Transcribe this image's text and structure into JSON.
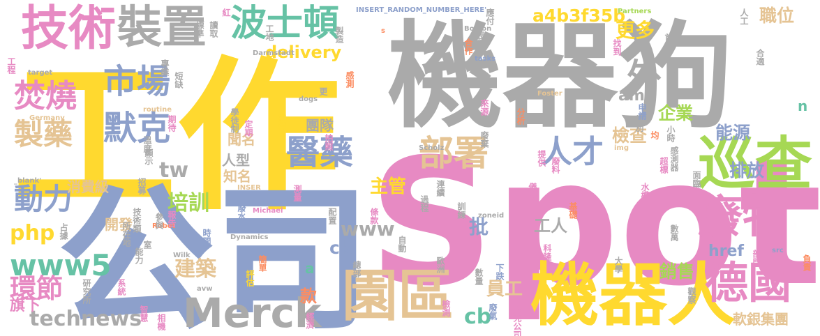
{
  "colors": {
    "gray": "#aaaaaa",
    "yellow": "#ffd92f",
    "pink": "#e78ac3",
    "blue": "#8da0cb",
    "green": "#a6d854",
    "teal": "#66c2a5",
    "orange": "#fc8d62",
    "tan": "#e5c494"
  },
  "words": [
    {
      "text": "機器狗",
      "color": "gray"
    },
    {
      "text": "工作",
      "color": "yellow"
    },
    {
      "text": "Spot",
      "color": "pink"
    },
    {
      "text": "公司",
      "color": "blue"
    },
    {
      "text": "機器人",
      "color": "yellow"
    },
    {
      "text": "巡查",
      "color": "green"
    },
    {
      "text": "廢物",
      "color": "pink"
    },
    {
      "text": "德國",
      "color": "pink"
    },
    {
      "text": "園區",
      "color": "tan"
    },
    {
      "text": "技術",
      "color": "pink"
    },
    {
      "text": "裝置",
      "color": "gray"
    },
    {
      "text": "波士頓",
      "color": "teal"
    },
    {
      "text": "Merck",
      "color": "gray"
    },
    {
      "text": "部署",
      "color": "tan"
    },
    {
      "text": "醫藥",
      "color": "blue"
    },
    {
      "text": "人才",
      "color": "blue"
    },
    {
      "text": "市場",
      "color": "blue"
    },
    {
      "text": "默克",
      "color": "blue"
    },
    {
      "text": "焚燒",
      "color": "pink"
    },
    {
      "text": "製藥",
      "color": "tan"
    },
    {
      "text": "外",
      "color": "gray"
    },
    {
      "text": "動力",
      "color": "blue"
    },
    {
      "text": "www5",
      "color": "teal"
    },
    {
      "text": "technews",
      "color": "gray"
    },
    {
      "text": "環節",
      "color": "pink"
    },
    {
      "text": "a4b3f35b",
      "color": "yellow"
    },
    {
      "text": "delivery",
      "color": "yellow"
    },
    {
      "text": "更多",
      "color": "yellow"
    },
    {
      "text": "職位",
      "color": "tan"
    },
    {
      "text": "amp",
      "color": "gray"
    },
    {
      "text": "企業",
      "color": "green"
    },
    {
      "text": "能源",
      "color": "blue"
    },
    {
      "text": "檢查",
      "color": "tan"
    },
    {
      "text": "排放",
      "color": "blue"
    },
    {
      "text": "主管",
      "color": "yellow"
    },
    {
      "text": "培訓",
      "color": "green"
    },
    {
      "text": "www",
      "color": "gray"
    },
    {
      "text": "批",
      "color": "blue"
    },
    {
      "text": "工人",
      "color": "gray"
    },
    {
      "text": "php",
      "color": "yellow"
    },
    {
      "text": "建築",
      "color": "tan"
    },
    {
      "text": "員工",
      "color": "tan"
    },
    {
      "text": "銷售",
      "color": "green"
    },
    {
      "text": "href",
      "color": "blue"
    },
    {
      "text": "軟銀集團",
      "color": "tan"
    },
    {
      "text": "團隊",
      "color": "gray"
    },
    {
      "text": "聞名",
      "color": "tan"
    },
    {
      "text": "人型",
      "color": "gray"
    },
    {
      "text": "知名",
      "color": "tan"
    },
    {
      "text": "tw",
      "color": "gray"
    },
    {
      "text": "消費級",
      "color": "tan"
    },
    {
      "text": "開發",
      "color": "tan"
    },
    {
      "text": "旗下",
      "color": "pink"
    },
    {
      "text": "ck",
      "color": "blue"
    },
    {
      "text": "cb",
      "color": "teal"
    },
    {
      "text": "款",
      "color": "orange"
    },
    {
      "text": "a",
      "color": "teal"
    },
    {
      "text": "n",
      "color": "teal"
    },
    {
      "text": "INSERT_RANDOM_NUMBER_HERE'",
      "color": "blue"
    },
    {
      "text": "Partners",
      "color": "green"
    },
    {
      "text": "Boston",
      "color": "gray"
    },
    {
      "text": "Darmstadt",
      "color": "gray"
    },
    {
      "text": "Scholz",
      "color": "gray"
    },
    {
      "text": "Dynamics",
      "color": "gray"
    },
    {
      "text": "Michael",
      "color": "pink"
    },
    {
      "text": "Robot",
      "color": "orange"
    },
    {
      "text": "Foster",
      "color": "tan"
    },
    {
      "text": "Dorian",
      "color": "gray"
    },
    {
      "text": "Germany",
      "color": "tan"
    },
    {
      "text": "routine",
      "color": "tan"
    },
    {
      "text": "target",
      "color": "gray"
    },
    {
      "text": "dogs",
      "color": "gray"
    },
    {
      "text": "tasks",
      "color": "blue"
    },
    {
      "text": "zoneid",
      "color": "gray"
    },
    {
      "text": "Wilk",
      "color": "gray"
    },
    {
      "text": "avw",
      "color": "gray"
    },
    {
      "text": "INSER",
      "color": "tan"
    },
    {
      "text": "_blank'",
      "color": "gray"
    },
    {
      "text": "img",
      "color": "tan"
    },
    {
      "text": "src",
      "color": "blue"
    },
    {
      "text": "s",
      "color": "orange"
    },
    {
      "text": "學徒制",
      "color": "gray"
    },
    {
      "text": "定期",
      "color": "pink"
    },
    {
      "text": "持續",
      "color": "yellow"
    },
    {
      "text": "拍照",
      "color": "pink"
    },
    {
      "text": "條款",
      "color": "pink"
    },
    {
      "text": "配置",
      "color": "gray"
    },
    {
      "text": "廢水",
      "color": "blue"
    },
    {
      "text": "參與",
      "color": "gray"
    },
    {
      "text": "技術類",
      "color": "gray"
    },
    {
      "text": "所在地",
      "color": "gray"
    },
    {
      "text": "占據",
      "color": "gray"
    },
    {
      "text": "報告",
      "color": "pink"
    },
    {
      "text": "時間",
      "color": "blue"
    },
    {
      "text": "簡單",
      "color": "orange"
    },
    {
      "text": "評估",
      "color": "yellow"
    },
    {
      "text": "總部",
      "color": "gray"
    },
    {
      "text": "自動",
      "color": "gray"
    },
    {
      "text": "歐洲",
      "color": "gray"
    },
    {
      "text": "下跌",
      "color": "blue"
    },
    {
      "text": "數量",
      "color": "gray"
    },
    {
      "text": "檢測",
      "color": "pink"
    },
    {
      "text": "廢氣",
      "color": "blue"
    },
    {
      "text": "默克公司",
      "color": "pink"
    },
    {
      "text": "科隆",
      "color": "pink"
    },
    {
      "text": "大學",
      "color": "gray"
    },
    {
      "text": "部門",
      "color": "pink"
    },
    {
      "text": "負責",
      "color": "orange"
    },
    {
      "text": "觀察",
      "color": "gray"
    },
    {
      "text": "經濟",
      "color": "pink"
    },
    {
      "text": "相機",
      "color": "pink"
    },
    {
      "text": "智慧",
      "color": "pink"
    },
    {
      "text": "系統",
      "color": "pink"
    },
    {
      "text": "研究所",
      "color": "gray"
    },
    {
      "text": "能力",
      "color": "gray"
    },
    {
      "text": "室",
      "color": "gray"
    },
    {
      "text": "招募",
      "color": "gray"
    },
    {
      "text": "顯示",
      "color": "gray"
    },
    {
      "text": "溫度",
      "color": "gray"
    },
    {
      "text": "期待",
      "color": "pink"
    },
    {
      "text": "短缺",
      "color": "gray"
    },
    {
      "text": "專業",
      "color": "gray"
    },
    {
      "text": "工程",
      "color": "pink"
    },
    {
      "text": "標準",
      "color": "gray"
    },
    {
      "text": "讀取",
      "color": "gray"
    },
    {
      "text": "紅",
      "color": "pink"
    },
    {
      "text": "工地",
      "color": "gray"
    },
    {
      "text": "製造",
      "color": "gray"
    },
    {
      "text": "長期",
      "color": "gray"
    },
    {
      "text": "應付",
      "color": "gray"
    },
    {
      "text": "人工",
      "color": "gray"
    },
    {
      "text": "首圖",
      "color": "gray"
    },
    {
      "text": "找到",
      "color": "pink"
    },
    {
      "text": "合作",
      "color": "orange"
    },
    {
      "text": "感測",
      "color": "orange"
    },
    {
      "text": "更",
      "color": "gray"
    },
    {
      "text": "來源",
      "color": "pink"
    },
    {
      "text": "分析",
      "color": "orange"
    },
    {
      "text": "服務",
      "color": "gray"
    },
    {
      "text": "合適",
      "color": "gray"
    },
    {
      "text": "特別",
      "color": "gray"
    },
    {
      "text": "申請",
      "color": "blue"
    },
    {
      "text": "小時",
      "color": "gray"
    },
    {
      "text": "廢棄",
      "color": "gray"
    },
    {
      "text": "提供",
      "color": "pink"
    },
    {
      "text": "廢料",
      "color": "pink"
    },
    {
      "text": "均",
      "color": "orange"
    },
    {
      "text": "感測器",
      "color": "gray"
    },
    {
      "text": "超標",
      "color": "pink"
    },
    {
      "text": "面臨",
      "color": "gray"
    },
    {
      "text": "儀表",
      "color": "pink"
    },
    {
      "text": "水槽",
      "color": "pink"
    },
    {
      "text": "連續",
      "color": "gray"
    },
    {
      "text": "過程",
      "color": "gray"
    },
    {
      "text": "訓練",
      "color": "gray"
    },
    {
      "text": "測量",
      "color": "pink"
    },
    {
      "text": "基礎",
      "color": "orange"
    },
    {
      "text": "數萬",
      "color": "gray"
    },
    {
      "text": "首",
      "color": "pink"
    }
  ]
}
